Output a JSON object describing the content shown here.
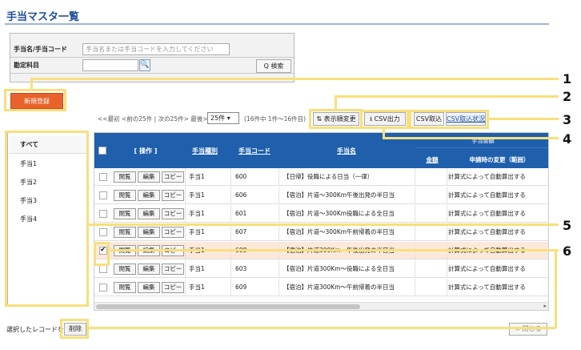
{
  "app": {
    "title": "手当マスタ一覧"
  },
  "search": {
    "name_label": "手当名/手当コード",
    "name_placeholder": "手当名または手当コードを入力してください",
    "account_label": "勘定科目",
    "lookup_icon": "magnifier-icon",
    "search_button": "Q 検索"
  },
  "toolbar": {
    "new_button": "新規登録",
    "pager": "<<最初 <前の25件 | 次の25件> 最後>>",
    "per_page": "25件 ▾",
    "range": "(16件中 1件〜16件目)",
    "display_order_button": "⇅ 表示順変更",
    "csv_export_button": "⭳ CSV出力",
    "csv_import_button": "CSV取込",
    "csv_status_link": "CSV取込状況"
  },
  "sidebar": {
    "items": [
      "すべて",
      "手当1",
      "手当2",
      "手当3",
      "手当4"
    ]
  },
  "table": {
    "headers": {
      "ops": "[ 操作 ]",
      "type": "手当種別",
      "code": "手当コード",
      "name": "手当名",
      "allowance_group": "手当金額",
      "amount": "金額",
      "change": "申請時の変更（範囲）"
    },
    "action_labels": [
      "閲覧",
      "編集",
      "コピー"
    ],
    "rows": [
      {
        "type": "手当1",
        "code": "600",
        "name": "【日帰】役職による日当（一律）",
        "change": "計算式によって自動算出する",
        "checked": false
      },
      {
        "type": "手当1",
        "code": "606",
        "name": "【宿泊】片道〜300Km午後出発の半日当",
        "change": "計算式によって自動算出する",
        "checked": false
      },
      {
        "type": "手当1",
        "code": "601",
        "name": "【宿泊】片道〜300Km役職による全日当",
        "change": "計算式によって自動算出する",
        "checked": false
      },
      {
        "type": "手当1",
        "code": "607",
        "name": "【宿泊】片道〜300Km午前帰着の半日当",
        "change": "計算式によって自動算出する",
        "checked": false
      },
      {
        "type": "手当1",
        "code": "608",
        "name": "【宿泊】片道300Km〜午後出発の半日当",
        "change": "計算式によって自動算出する",
        "checked": true
      },
      {
        "type": "手当1",
        "code": "603",
        "name": "【宿泊】片道300Km〜役職による全日当",
        "change": "計算式によって自動算出する",
        "checked": false
      },
      {
        "type": "手当1",
        "code": "609",
        "name": "【宿泊】片道300Km〜午前帰着の半日当",
        "change": "計算式によって自動算出する",
        "checked": false
      }
    ]
  },
  "footer": {
    "selected_label": "選択したレコードを",
    "delete_button": "削除",
    "close_button": "× 閉じる"
  },
  "callouts": [
    "1",
    "2",
    "3",
    "4",
    "5",
    "6"
  ],
  "colors": {
    "header_blue": "#1f5fac",
    "new_button": "#e8622a",
    "callout": "#f8df7c"
  }
}
